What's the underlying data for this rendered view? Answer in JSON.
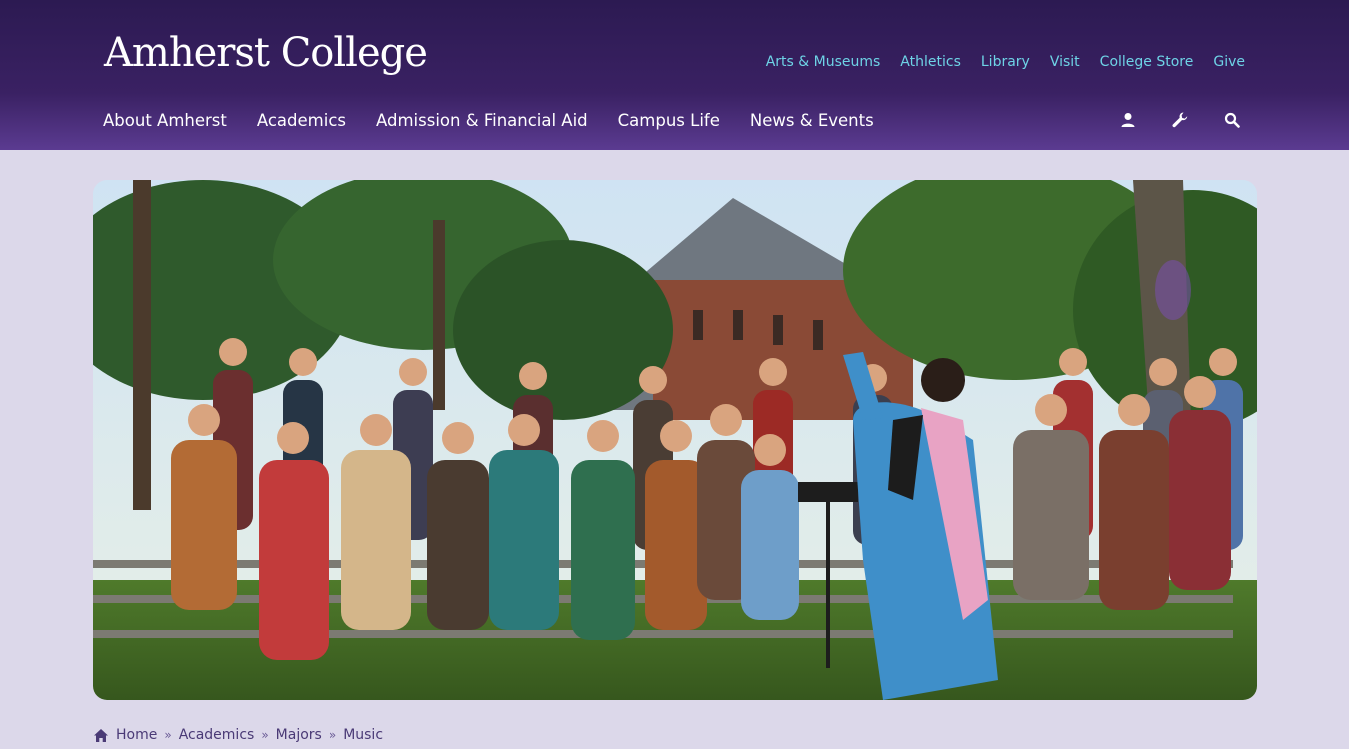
{
  "header": {
    "logo": "Amherst College",
    "utility_nav": [
      "Arts & Museums",
      "Athletics",
      "Library",
      "Visit",
      "College Store",
      "Give"
    ],
    "main_nav": [
      "About Amherst",
      "Academics",
      "Admission & Financial Aid",
      "Campus Life",
      "News & Events"
    ],
    "icons": [
      "user-icon",
      "wrench-icon",
      "search-icon"
    ]
  },
  "hero": {
    "description_icon": "hero-image"
  },
  "breadcrumb": {
    "home_icon": "home-icon",
    "items": [
      "Home",
      "Academics",
      "Majors",
      "Music"
    ],
    "separator": "»"
  },
  "colors": {
    "header_dark": "#2c1a52",
    "header_light": "#5b3b91",
    "utility_link": "#6ed3e6",
    "page_bg": "#dcd8ea",
    "breadcrumb_text": "#4a3a76"
  }
}
